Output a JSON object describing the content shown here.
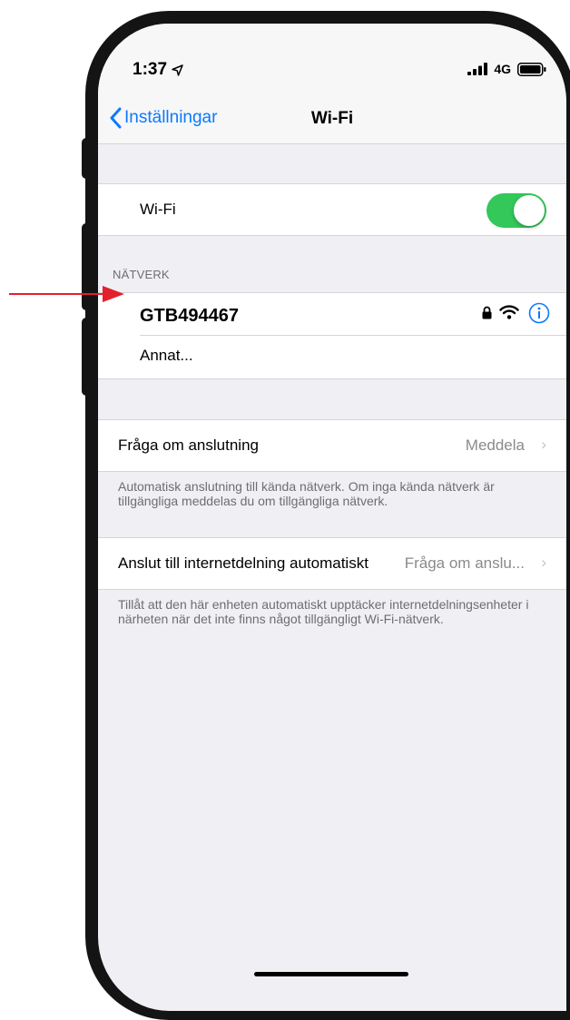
{
  "status_bar": {
    "time": "1:37",
    "carrier": "4G"
  },
  "nav": {
    "back_label": "Inställningar",
    "title": "Wi-Fi"
  },
  "wifi_toggle": {
    "label": "Wi-Fi",
    "on": true
  },
  "networks": {
    "header": "NÄTVERK",
    "connected": {
      "name": "GTB494467",
      "secured": true
    },
    "other_label": "Annat..."
  },
  "ask_to_join": {
    "label": "Fråga om anslutning",
    "value": "Meddela",
    "footer": "Automatisk anslutning till kända nätverk. Om inga kända nätverk är tillgängliga meddelas du om tillgängliga nätverk."
  },
  "auto_hotspot": {
    "label": "Anslut till internetdelning automatiskt",
    "value": "Fråga om anslu...",
    "footer": "Tillåt att den här enheten automatiskt upptäcker internetdelningsenheter i närheten när det inte finns något tillgängligt Wi-Fi-nätverk."
  },
  "colors": {
    "accent": "#0a7aff",
    "toggle_on": "#34c759",
    "annotation_arrow": "#e3202b"
  },
  "icons": [
    "location-arrow-icon",
    "signal-icon",
    "battery-icon",
    "chevron-left-icon",
    "lock-icon",
    "wifi-icon",
    "info-icon",
    "chevron-right-icon"
  ]
}
